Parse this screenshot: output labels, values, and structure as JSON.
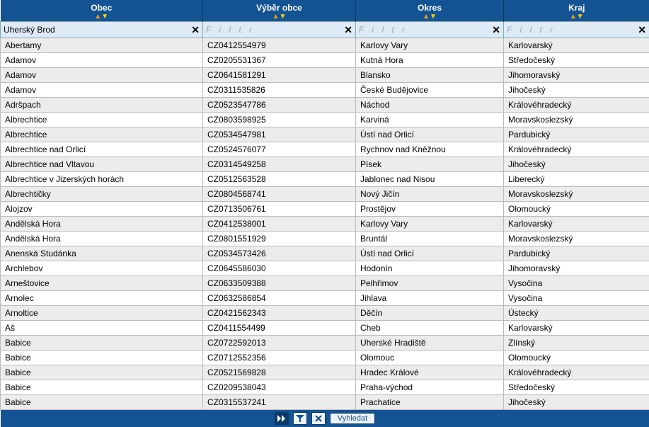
{
  "header": {
    "columns": [
      {
        "key": "obec",
        "label": "Obec"
      },
      {
        "key": "vyber",
        "label": "Výběr obce"
      },
      {
        "key": "okres",
        "label": "Okres"
      },
      {
        "key": "kraj",
        "label": "Kraj"
      }
    ]
  },
  "filters": {
    "obec": {
      "value": "Uherský Brod",
      "placeholder": ""
    },
    "vyber": {
      "value": "",
      "placeholder": "F i l t r"
    },
    "okres": {
      "value": "",
      "placeholder": "F i l t r"
    },
    "kraj": {
      "value": "",
      "placeholder": "F i l t r"
    }
  },
  "rows": [
    {
      "obec": "Abertamy",
      "vyber": "CZ0412554979",
      "okres": "Karlovy Vary",
      "kraj": "Karlovarský"
    },
    {
      "obec": "Adamov",
      "vyber": "CZ0205531367",
      "okres": "Kutná Hora",
      "kraj": "Středočeský"
    },
    {
      "obec": "Adamov",
      "vyber": "CZ0641581291",
      "okres": "Blansko",
      "kraj": "Jihomoravský"
    },
    {
      "obec": "Adamov",
      "vyber": "CZ0311535826",
      "okres": "České Budějovice",
      "kraj": "Jihočeský"
    },
    {
      "obec": "Adršpach",
      "vyber": "CZ0523547786",
      "okres": "Náchod",
      "kraj": "Královéhradecký"
    },
    {
      "obec": "Albrechtice",
      "vyber": "CZ0803598925",
      "okres": "Karviná",
      "kraj": "Moravskoslezský"
    },
    {
      "obec": "Albrechtice",
      "vyber": "CZ0534547981",
      "okres": "Ústí nad Orlicí",
      "kraj": "Pardubický"
    },
    {
      "obec": "Albrechtice nad Orlicí",
      "vyber": "CZ0524576077",
      "okres": "Rychnov nad Kněžnou",
      "kraj": "Královéhradecký"
    },
    {
      "obec": "Albrechtice nad Vltavou",
      "vyber": "CZ0314549258",
      "okres": "Písek",
      "kraj": "Jihočeský"
    },
    {
      "obec": "Albrechtice v Jizerských horách",
      "vyber": "CZ0512563528",
      "okres": "Jablonec nad Nisou",
      "kraj": "Liberecký"
    },
    {
      "obec": "Albrechtičky",
      "vyber": "CZ0804568741",
      "okres": "Nový Jičín",
      "kraj": "Moravskoslezský"
    },
    {
      "obec": "Alojzov",
      "vyber": "CZ0713506761",
      "okres": "Prostějov",
      "kraj": "Olomoucký"
    },
    {
      "obec": "Andělská Hora",
      "vyber": "CZ0412538001",
      "okres": "Karlovy Vary",
      "kraj": "Karlovarský"
    },
    {
      "obec": "Andělská Hora",
      "vyber": "CZ0801551929",
      "okres": "Bruntál",
      "kraj": "Moravskoslezský"
    },
    {
      "obec": "Anenská Studánka",
      "vyber": "CZ0534573426",
      "okres": "Ústí nad Orlicí",
      "kraj": "Pardubický"
    },
    {
      "obec": "Archlebov",
      "vyber": "CZ0645586030",
      "okres": "Hodonín",
      "kraj": "Jihomoravský"
    },
    {
      "obec": "Arneštovice",
      "vyber": "CZ0633509388",
      "okres": "Pelhřimov",
      "kraj": "Vysočina"
    },
    {
      "obec": "Arnolec",
      "vyber": "CZ0632586854",
      "okres": "Jihlava",
      "kraj": "Vysočina"
    },
    {
      "obec": "Arnoltice",
      "vyber": "CZ0421562343",
      "okres": "Děčín",
      "kraj": "Ústecký"
    },
    {
      "obec": "Aš",
      "vyber": "CZ0411554499",
      "okres": "Cheb",
      "kraj": "Karlovarský"
    },
    {
      "obec": "Babice",
      "vyber": "CZ0722592013",
      "okres": "Uherské Hradiště",
      "kraj": "Zlínský"
    },
    {
      "obec": "Babice",
      "vyber": "CZ0712552356",
      "okres": "Olomouc",
      "kraj": "Olomoucký"
    },
    {
      "obec": "Babice",
      "vyber": "CZ0521569828",
      "okres": "Hradec Králové",
      "kraj": "Královéhradecký"
    },
    {
      "obec": "Babice",
      "vyber": "CZ0209538043",
      "okres": "Praha-východ",
      "kraj": "Středočeský"
    },
    {
      "obec": "Babice",
      "vyber": "CZ0315537241",
      "okres": "Prachatice",
      "kraj": "Jihočeský"
    }
  ],
  "footer": {
    "search_label": "Vyhledat"
  }
}
